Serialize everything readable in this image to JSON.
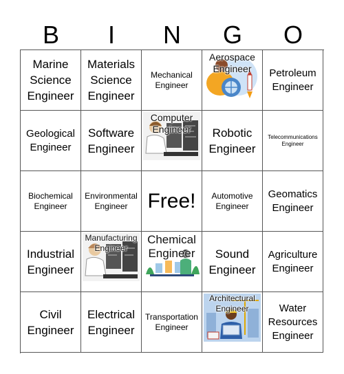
{
  "title_letters": [
    "B",
    "I",
    "N",
    "G",
    "O"
  ],
  "cells": [
    {
      "label": "Marine Science Engineer",
      "size": "l"
    },
    {
      "label": "Materials Science Engineer",
      "size": "l"
    },
    {
      "label": "Mechanical Engineer",
      "size": "s"
    },
    {
      "label": "Aerospace Engineer",
      "image": "aerospace-engineer-illustration"
    },
    {
      "label": "Petroleum Engineer",
      "size": "m"
    },
    {
      "label": "Geological Engineer",
      "size": "m"
    },
    {
      "label": "Software Engineer",
      "size": "l"
    },
    {
      "label": "Computer Engineer",
      "image": "computer-engineer-illustration"
    },
    {
      "label": "Robotic Engineer",
      "size": "l"
    },
    {
      "label": "Telecommunications Engineer",
      "size": "xs"
    },
    {
      "label": "Biochemical Engineer",
      "size": "s"
    },
    {
      "label": "Environmental Engineer",
      "size": "s"
    },
    {
      "label": "Free!",
      "size": "free"
    },
    {
      "label": "Automotive Engineer",
      "size": "s"
    },
    {
      "label": "Geomatics Engineer",
      "size": "m"
    },
    {
      "label": "Industrial Engineer",
      "size": "l"
    },
    {
      "label": "Manufacturing Engineer",
      "image": "manufacturing-engineer-illustration"
    },
    {
      "label": "Chemical Engineer",
      "image": "chemical-engineer-illustration"
    },
    {
      "label": "Sound Engineer",
      "size": "l"
    },
    {
      "label": "Agriculture Engineer",
      "size": "m"
    },
    {
      "label": "Civil Engineer",
      "size": "l"
    },
    {
      "label": "Electrical Engineer",
      "size": "l"
    },
    {
      "label": "Transportation Engineer",
      "size": "s"
    },
    {
      "label": "Architectural Engineer",
      "image": "architectural-engineer-illustration"
    },
    {
      "label": "Water Resources Engineer",
      "size": "m"
    }
  ],
  "colors": {
    "grid_line": "#555555",
    "text": "#000000",
    "background": "#ffffff"
  }
}
